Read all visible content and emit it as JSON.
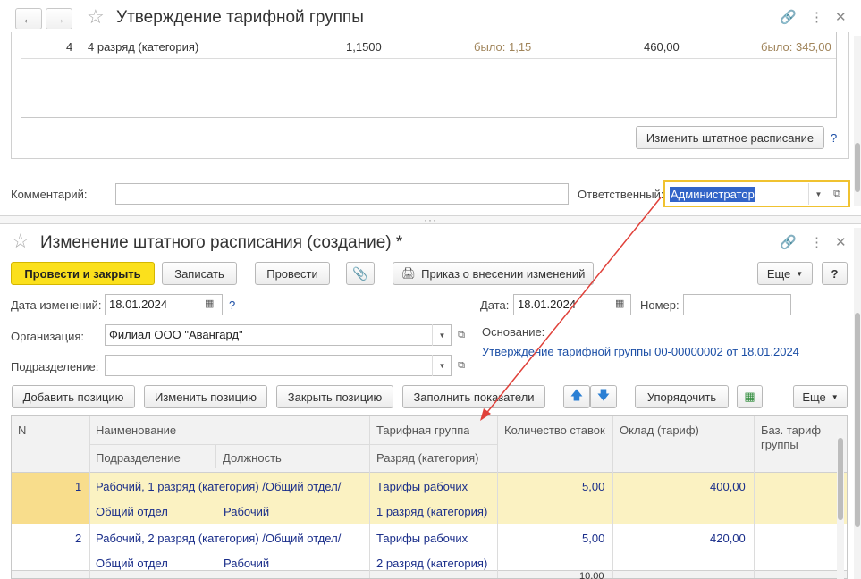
{
  "top_form": {
    "title": "Утверждение тарифной группы",
    "row": {
      "n": "4",
      "name": "4 разряд (категория)",
      "coef": "1,1500",
      "was_coef": "было: 1,15",
      "salary": "460,00",
      "was_salary": "было: 345,00"
    },
    "change_schedule_button": "Изменить штатное расписание",
    "help": "?",
    "comment_label": "Комментарий:",
    "comment_value": "",
    "responsible_label": "Ответственный:",
    "responsible_value": "Администратор"
  },
  "bottom_form": {
    "title": "Изменение штатного расписания (создание) *",
    "toolbar": {
      "post_close": "Провести и закрыть",
      "save": "Записать",
      "post": "Провести",
      "order": "Приказ о внесении изменений",
      "more": "Еще",
      "help": "?"
    },
    "fields": {
      "change_date_label": "Дата изменений:",
      "change_date_value": "18.01.2024",
      "help": "?",
      "date_label": "Дата:",
      "date_value": "18.01.2024",
      "number_label": "Номер:",
      "number_value": "",
      "org_label": "Организация:",
      "org_value": "Филиал ООО \"Авангард\"",
      "basis_label": "Основание:",
      "basis_link": "Утверждение тарифной группы 00-00000002 от 18.01.2024",
      "dept_label": "Подразделение:",
      "dept_value": ""
    },
    "table_toolbar": {
      "add": "Добавить позицию",
      "edit": "Изменить позицию",
      "close": "Закрыть позицию",
      "fill": "Заполнить показатели",
      "sort": "Упорядочить",
      "more": "Еще"
    },
    "columns": {
      "n": "N",
      "name": "Наименование",
      "dept": "Подразделение",
      "position": "Должность",
      "tariff_group": "Тарифная группа",
      "grade": "Разряд (категория)",
      "rate_count": "Количество ставок",
      "salary": "Оклад (тариф)",
      "base_tariff_1": "Баз. тариф",
      "base_tariff_2": "группы"
    },
    "rows": [
      {
        "n": "1",
        "name": "Рабочий, 1 разряд (категория) /Общий отдел/",
        "dept": "Общий отдел",
        "position": "Рабочий",
        "tariff_group": "Тарифы рабочих",
        "grade": "1 разряд (категория)",
        "rate_count": "5,00",
        "salary": "400,00"
      },
      {
        "n": "2",
        "name": "Рабочий, 2 разряд (категория) /Общий отдел/",
        "dept": "Общий отдел",
        "position": "Рабочий",
        "tariff_group": "Тарифы рабочих",
        "grade": "2 разряд (категория)",
        "rate_count": "5,00",
        "salary": "420,00"
      }
    ],
    "footer_total": "10,00"
  },
  "colors": {
    "accent": "#fbe01c",
    "selected_row": "#fbf2c2",
    "link": "#1c4fa6",
    "arrow": "#e0413a"
  }
}
